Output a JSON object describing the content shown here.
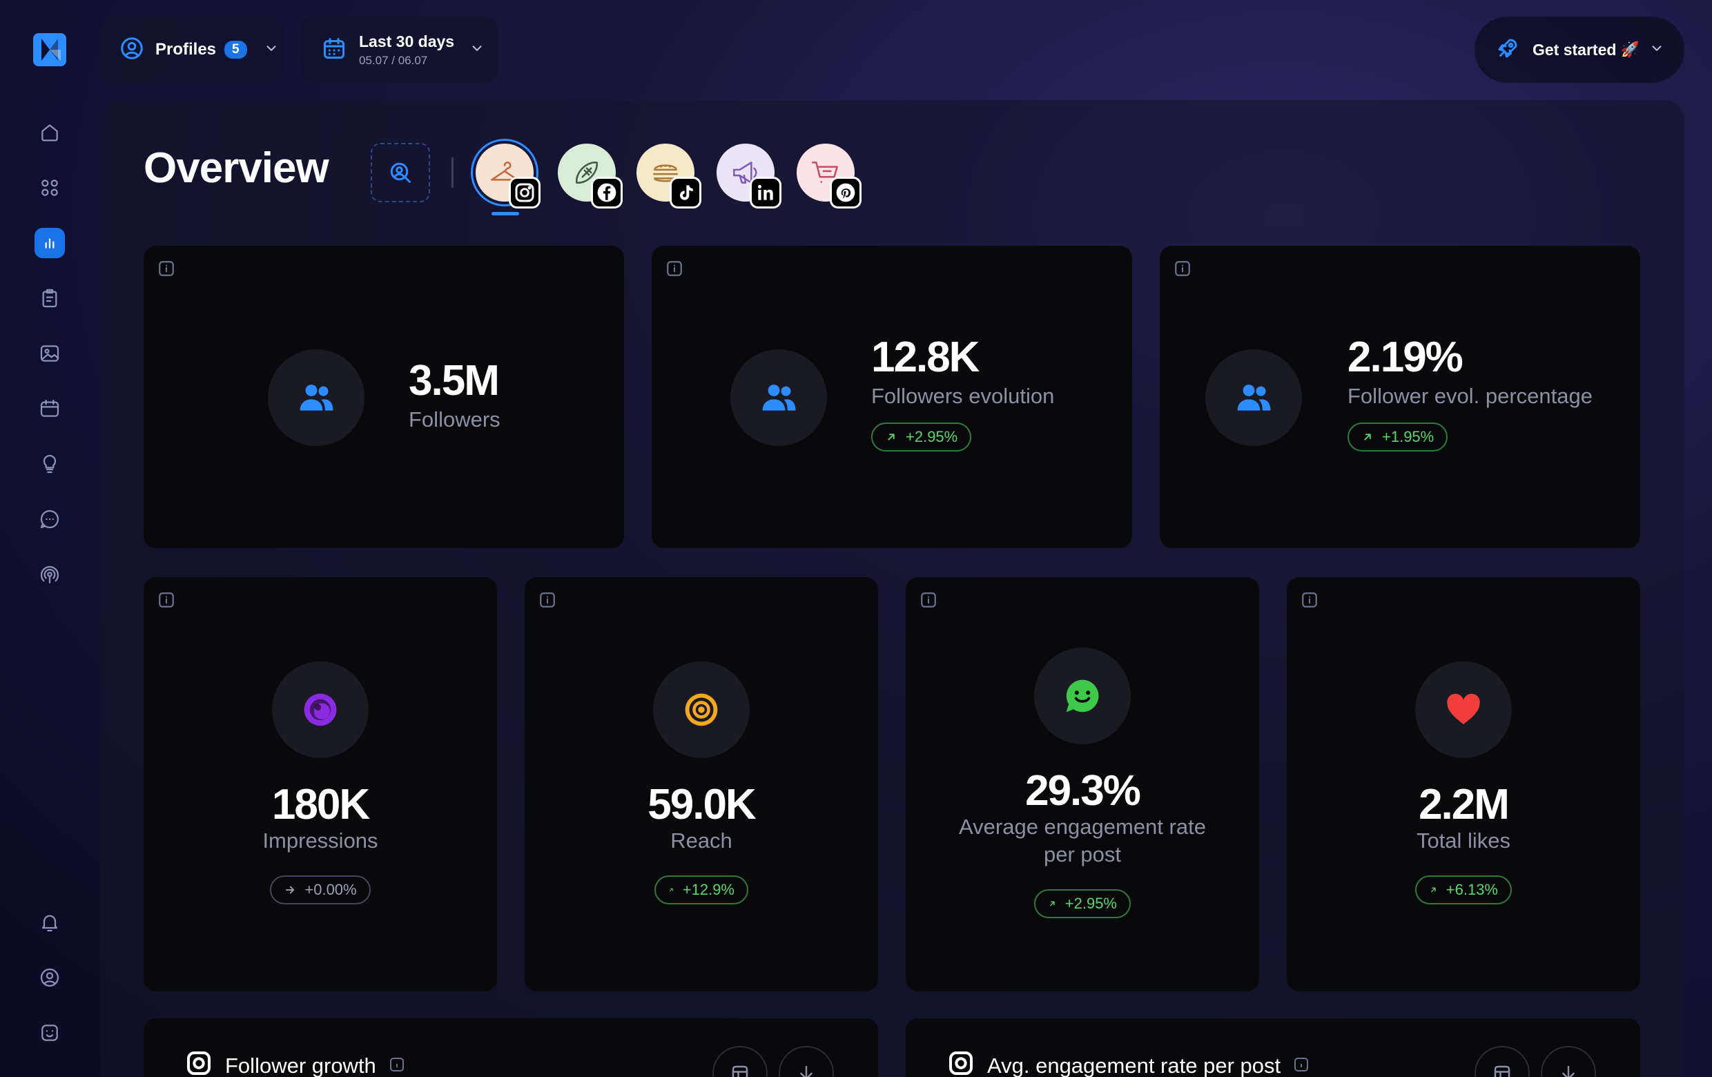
{
  "header": {
    "profiles_label": "Profiles",
    "profiles_count": "5",
    "date_title": "Last 30 days",
    "date_range": "05.07 / 06.07",
    "get_started_label": "Get started",
    "get_started_emoji": "🚀"
  },
  "page": {
    "title": "Overview"
  },
  "profiles": [
    {
      "icon": "hanger-icon",
      "network": "instagram",
      "bg": "#f6e3d2",
      "stroke": "#c8663a",
      "selected": true
    },
    {
      "icon": "football-icon",
      "network": "facebook",
      "bg": "#d8ecd8",
      "stroke": "#3d5a43",
      "selected": false
    },
    {
      "icon": "burger-icon",
      "network": "tiktok",
      "bg": "#f5e9c8",
      "stroke": "#a8793a",
      "selected": false
    },
    {
      "icon": "megaphone-icon",
      "network": "linkedin",
      "bg": "#ebe3f6",
      "stroke": "#7d5ab8",
      "selected": false
    },
    {
      "icon": "cart-icon",
      "network": "pinterest",
      "bg": "#fbe3e6",
      "stroke": "#c94a62",
      "selected": false
    }
  ],
  "metrics_top": [
    {
      "value": "3.5M",
      "label": "Followers",
      "icon": "users-icon",
      "icon_color": "#2d8cff"
    },
    {
      "value": "12.8K",
      "label": "Followers evolution",
      "change": "+2.95%",
      "trend": "up",
      "icon": "users-icon",
      "icon_color": "#2d8cff"
    },
    {
      "value": "2.19%",
      "label": "Follower evol. percentage",
      "change": "+1.95%",
      "trend": "up",
      "icon": "users-icon",
      "icon_color": "#2d8cff"
    }
  ],
  "metrics_bottom": [
    {
      "value": "180K",
      "label": "Impressions",
      "change": "+0.00%",
      "trend": "flat",
      "icon": "eye-icon",
      "icon_color": "#8a2be2"
    },
    {
      "value": "59.0K",
      "label": "Reach",
      "change": "+12.9%",
      "trend": "up",
      "icon": "target-icon",
      "icon_color": "#f5a623"
    },
    {
      "value": "29.3%",
      "label_line1": "Average engagement rate",
      "label_line2": "per post",
      "change": "+2.95%",
      "trend": "up",
      "icon": "smile-chat-icon",
      "icon_color": "#3ec94a"
    },
    {
      "value": "2.2M",
      "label": "Total likes",
      "change": "+6.13%",
      "trend": "up",
      "icon": "heart-icon",
      "icon_color": "#f23d3d"
    }
  ],
  "sections": [
    {
      "title": "Follower growth"
    },
    {
      "title": "Avg. engagement rate per post"
    }
  ],
  "colors": {
    "accent": "#2d8cff",
    "positive": "#5ad66c",
    "card_bg": "#09090b"
  }
}
